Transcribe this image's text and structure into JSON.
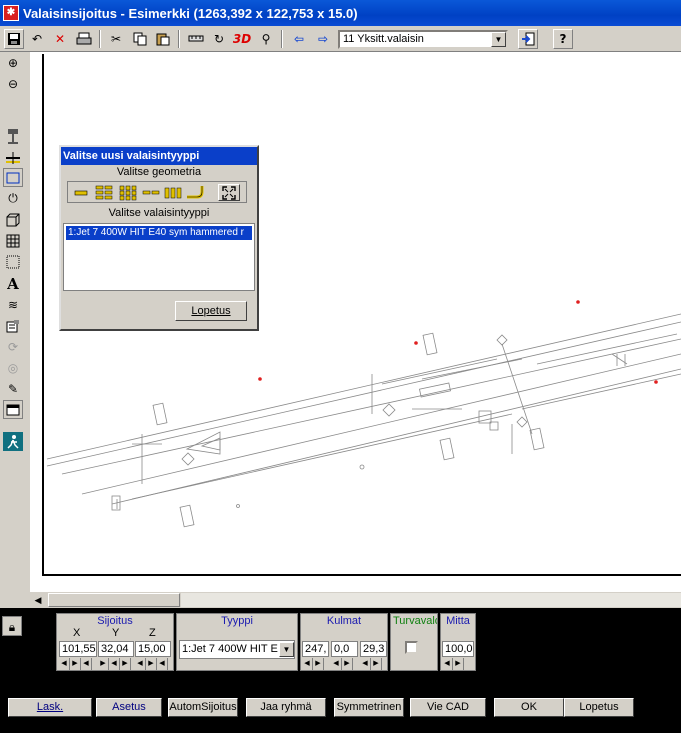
{
  "window": {
    "title": "Valaisinsijoitus - Esimerkki (1263,392 x 122,753 x 15.0)"
  },
  "toolbar": {
    "combo_value": "11 Yksitt.valaisin",
    "icons": [
      "save-icon",
      "undo-icon",
      "delete-icon",
      "print-icon",
      "cut-icon",
      "copy-icon",
      "paste-icon",
      "measure-icon",
      "rotate-icon",
      "3d-icon",
      "search-icon",
      "arrow-left-icon",
      "arrow-right-icon",
      "exit-icon",
      "help-icon"
    ],
    "label_3d": "3D",
    "help_glyph": "?"
  },
  "dialog": {
    "title": "Valitse uusi valaisintyyppi",
    "geometry_label": "Valitse geometria",
    "type_label": "Valitse valaisintyyppi",
    "list_items": [
      "1:Jet 7 400W HIT E40 sym hammered r"
    ],
    "close_button": "Lopetus"
  },
  "panel": {
    "sijoitus": {
      "title": "Sijoitus",
      "x_label": "X",
      "y_label": "Y",
      "z_label": "Z",
      "x": "101,55",
      "y": "32,04",
      "z": "15,00"
    },
    "tyyppi": {
      "title": "Tyyppi",
      "value": "1:Jet 7 400W HIT E"
    },
    "kulmat": {
      "title": "Kulmat",
      "a": "247,",
      "b": "0,0",
      "c": "29,3"
    },
    "turvavalo": {
      "title": "Turvavalo",
      "checked": false
    },
    "mitta": {
      "title": "Mitta",
      "value": "100,0"
    }
  },
  "buttons": {
    "lask": "Lask.",
    "asetus": "Asetus",
    "autom": "AutomSijoitus",
    "jaa": "Jaa ryhmä",
    "symm": "Symmetrinen",
    "vie": "Vie CAD",
    "ok": "OK",
    "lopetus": "Lopetus"
  },
  "colors": {
    "title_bar": "#0a4bd4",
    "selection": "#0a3fc9",
    "panel_label": "#1a1ab0",
    "turvavalo_label": "#108010",
    "light_marker": "#e02020"
  }
}
